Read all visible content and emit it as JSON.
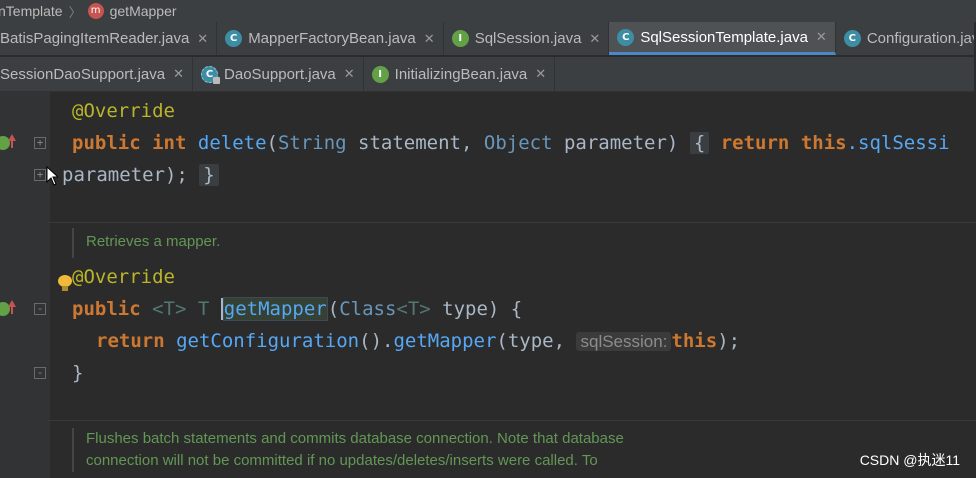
{
  "breadcrumb": {
    "class_crumb": "nTemplate",
    "method_icon": "m",
    "method_crumb": "getMapper"
  },
  "tabs_row1": [
    {
      "label": "BatisPagingItemReader.java",
      "icon": "class-icon"
    },
    {
      "label": "MapperFactoryBean.java",
      "icon": "class-icon"
    },
    {
      "label": "SqlSession.java",
      "icon": "interface-icon"
    },
    {
      "label": "SqlSessionTemplate.java",
      "icon": "class-icon",
      "active": true
    },
    {
      "label": "Configuration.java",
      "icon": "class-icon"
    }
  ],
  "tabs_row2": [
    {
      "label": "SessionDaoSupport.java",
      "icon": "abstract-class-icon"
    },
    {
      "label": "DaoSupport.java",
      "icon": "abstract-class-icon"
    },
    {
      "label": "InitializingBean.java",
      "icon": "interface-icon"
    }
  ],
  "tab_close_glyph": "✕",
  "icon_letters": {
    "class": "C",
    "interface": "I"
  },
  "code": {
    "l1": {
      "ann": "@Override"
    },
    "l2": {
      "kw1": "public",
      "kw2": "int",
      "fn": "delete",
      "open": "(",
      "t1": "String",
      "p1": " statement, ",
      "t2": "Object",
      "p2": " parameter)",
      "fold": "{",
      "kw3": "return",
      "kw4": "this",
      "rest": ".sqlSessi"
    },
    "l3": {
      "text": "parameter);",
      "fold": "}"
    },
    "doc1": "Retrieves a mapper.",
    "l5": {
      "ann": "@Override"
    },
    "l6": {
      "kw1": "public",
      "gen1": "<T>",
      "t": "T",
      "fn": "getMapper",
      "open": "(",
      "cls": "Class",
      "gen2": "<T>",
      "rest": " type) {"
    },
    "l7": {
      "kw": "return",
      "fn1": "getConfiguration",
      "mid": "().",
      "fn2": "getMapper",
      "open": "(type, ",
      "hint": "sqlSession:",
      "kw2": "this",
      "close": ");"
    },
    "l8": {
      "text": "}"
    },
    "doc2_line1": "Flushes batch statements and commits database connection. Note that database",
    "doc2_line2": "connection will not be committed if no updates/deletes/inserts were called. To"
  },
  "watermark": "CSDN @执迷11",
  "colors": {
    "background": "#2b2b2b",
    "keyword": "#cc7832",
    "annotation": "#bbb529",
    "method": "#56a8f5",
    "doc_comment": "#629755",
    "active_tab_underline": "#4a88c7"
  }
}
